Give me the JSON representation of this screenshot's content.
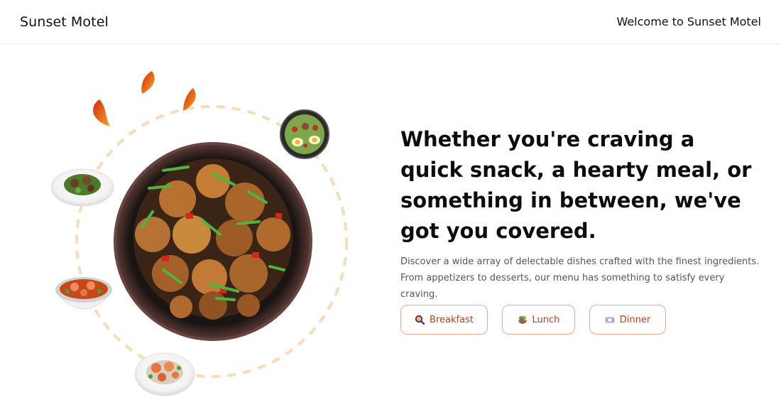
{
  "header": {
    "brand": "Sunset Motel",
    "welcome": "Welcome to Sunset Motel"
  },
  "hero": {
    "headline": "Whether you're craving a quick snack, a hearty meal, or something in between, we've got you covered.",
    "description": "Discover a wide array of delectable dishes crafted with the finest ingredients. From appetizers to desserts, our menu has something to satisfy every craving."
  },
  "menu_buttons": [
    {
      "label": "Breakfast",
      "icon": "magnifier-icon"
    },
    {
      "label": "Lunch",
      "icon": "salad-bowl-icon"
    },
    {
      "label": "Dinner",
      "icon": "plate-icon"
    }
  ],
  "colors": {
    "accent": "#c23b1a",
    "button_border": "#f2a58f",
    "orbit": "#f8dcb8"
  }
}
